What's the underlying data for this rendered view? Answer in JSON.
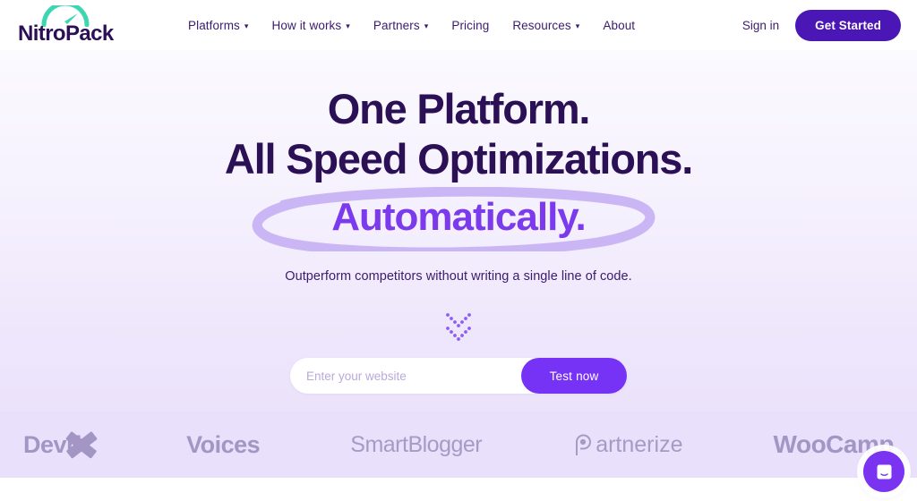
{
  "header": {
    "logo": {
      "text": "NitroPack",
      "icon": "speedometer-icon"
    },
    "nav": [
      {
        "label": "Platforms",
        "has_dropdown": true
      },
      {
        "label": "How it works",
        "has_dropdown": true
      },
      {
        "label": "Partners",
        "has_dropdown": true
      },
      {
        "label": "Pricing",
        "has_dropdown": false
      },
      {
        "label": "Resources",
        "has_dropdown": true
      },
      {
        "label": "About",
        "has_dropdown": false
      }
    ],
    "caret": "▾",
    "signin_label": "Sign in",
    "get_started_label": "Get Started"
  },
  "hero": {
    "headline_line1": "One Platform.",
    "headline_line2": "All Speed Optimizations.",
    "headline_highlight": "Automatically.",
    "subtitle": "Outperform competitors without writing a single line of code.",
    "scroll_hint_icon": "double-chevron-down-icon",
    "form": {
      "placeholder": "Enter your website",
      "value": "",
      "button_label": "Test now"
    }
  },
  "logo_strip": {
    "brands": [
      {
        "name": "DevriX",
        "label": "Devri"
      },
      {
        "name": "Voices",
        "label": "Voices"
      },
      {
        "name": "SmartBlogger",
        "label": "SmartBlogger"
      },
      {
        "name": "Partnerize",
        "label": "artnerize"
      },
      {
        "name": "WooCamp",
        "label": "WooCamp"
      }
    ]
  },
  "chat": {
    "icon": "chat-message-icon",
    "label": "Open chat"
  },
  "colors": {
    "brand_dark": "#2b1055",
    "accent_purple": "#7c3aed",
    "button_purple": "#4a16b5",
    "test_button": "#7633f5",
    "logo_arc_teal": "#3dd6b0",
    "ellipse_lavender": "#cbb6f5",
    "strip_bg": "#e9e0fb",
    "brand_gray": "#a395c4"
  }
}
